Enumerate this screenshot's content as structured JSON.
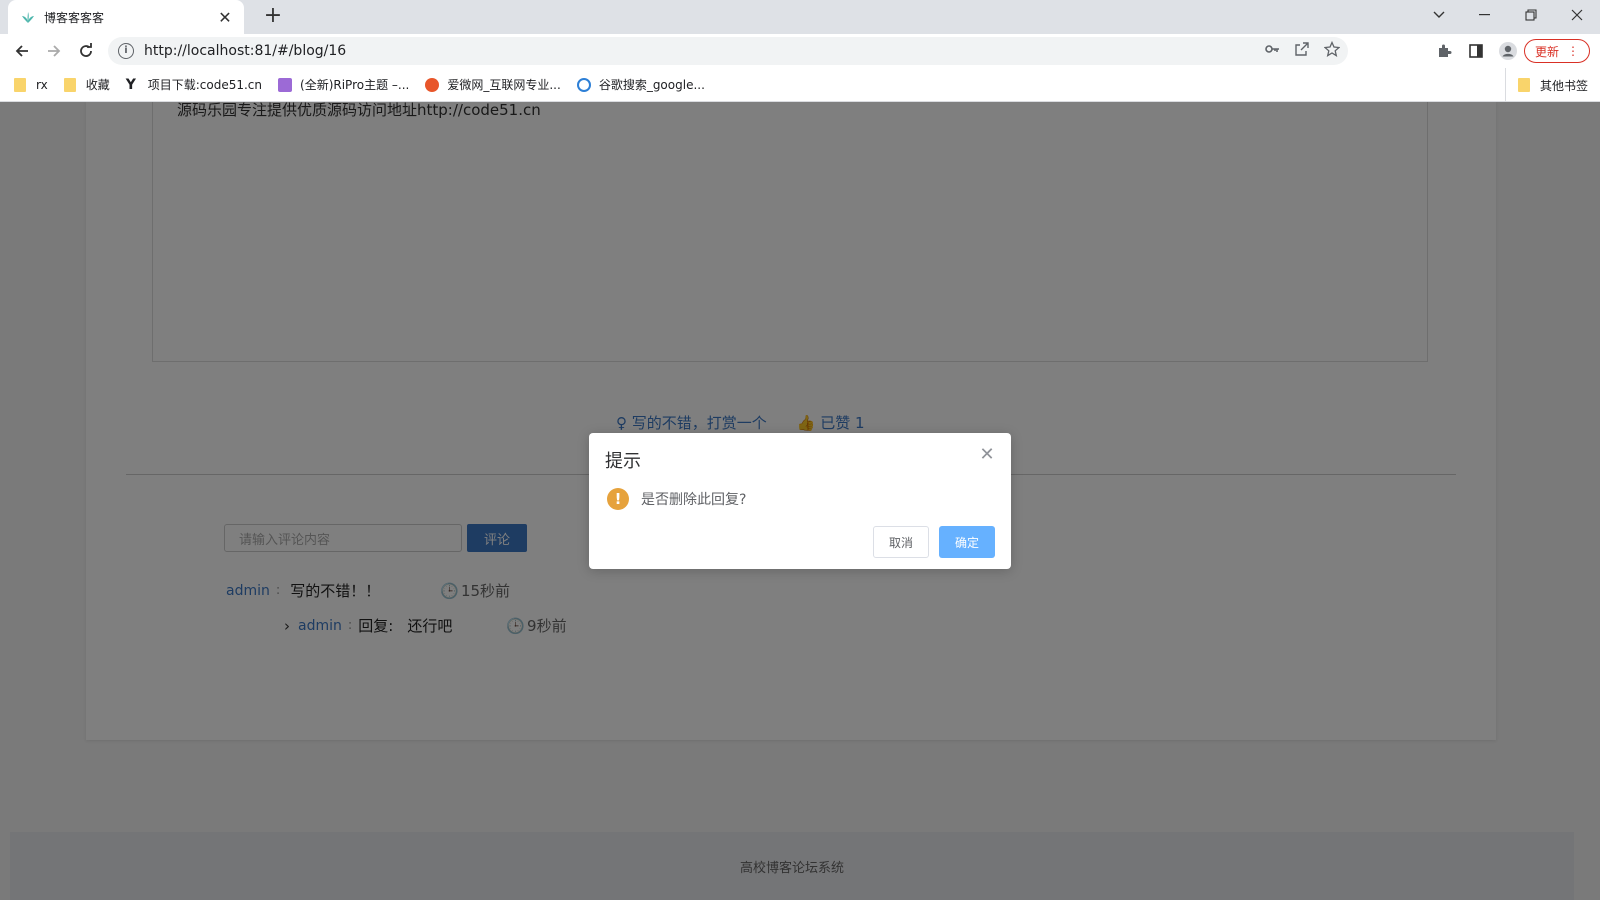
{
  "browser": {
    "tab_title": "博客客客客",
    "url": "http://localhost:81/#/blog/16",
    "update_label": "更新",
    "bookmarks": [
      "rx",
      "收藏",
      "项目下载:code51.cn",
      "(全新)RiPro主题 –...",
      "爱微网_互联网专业...",
      "谷歌搜索_google..."
    ],
    "other_bookmarks": "其他书签"
  },
  "page": {
    "content_text": "源码乐园专注提供优质源码访问地址http://code51.cn",
    "reward_label": "写的不错，打赏一个",
    "like_label": "已赞 1",
    "comment_placeholder": "请输入评论内容",
    "comment_button": "评论",
    "comments": [
      {
        "user": "admin",
        "text": "写的不错！！",
        "time": "15秒前"
      }
    ],
    "replies": [
      {
        "user": "admin",
        "prefix": "回复:",
        "text": "还行吧",
        "time": "9秒前"
      }
    ],
    "footer": "高校博客论坛系统"
  },
  "dialog": {
    "title": "提示",
    "message": "是否删除此回复?",
    "cancel": "取消",
    "confirm": "确定"
  },
  "colors": {
    "link": "#3d78c5",
    "warning": "#e6a23c",
    "primary": "#66b1ff"
  }
}
